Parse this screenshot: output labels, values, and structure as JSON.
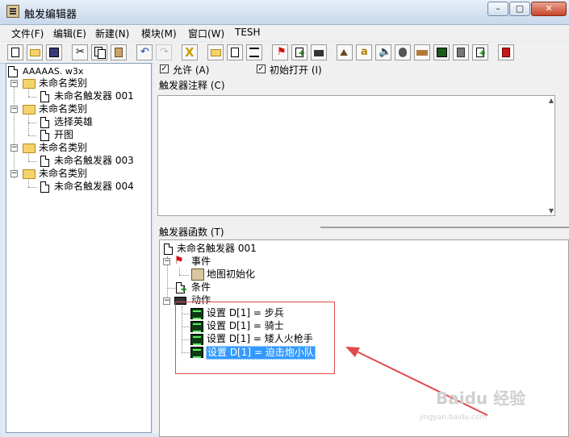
{
  "window": {
    "title": "触发编辑器"
  },
  "menu": [
    "文件(F)",
    "编辑(E)",
    "新建(N)",
    "模块(M)",
    "窗口(W)",
    "TESH"
  ],
  "left_tree": {
    "root": "AAAAAS. w3x",
    "categories": [
      {
        "label": "未命名类别",
        "children": [
          "未命名触发器 001"
        ]
      },
      {
        "label": "未命名类别",
        "children": [
          "选择英雄",
          "开图"
        ]
      },
      {
        "label": "未命名类别",
        "children": [
          "未命名触发器 003"
        ]
      },
      {
        "label": "未命名类别",
        "children": [
          "未命名触发器 004"
        ]
      }
    ]
  },
  "options": {
    "allow_label": "允许 (A)",
    "allow_checked": true,
    "initially_on_label": "初始打开 (I)",
    "initially_on_checked": true
  },
  "comment": {
    "label": "触发器注释 (C)",
    "value": ""
  },
  "functions": {
    "label": "触发器函数 (T)",
    "trigger_name": "未命名触发器 001",
    "events_label": "事件",
    "events": [
      "地图初始化"
    ],
    "conditions_label": "条件",
    "actions_label": "动作",
    "actions": [
      "设置 D[1] = 步兵",
      "设置 D[1] = 骑士",
      "设置 D[1] = 矮人火枪手",
      "设置 D[1] = 迫击炮小队"
    ],
    "selected_action_index": 3
  },
  "watermark": {
    "brand": "Baidu 经验",
    "url": "jingyan.baidu.com"
  },
  "colors": {
    "annotation_red": "#e04a4a",
    "selection_blue": "#3399ff"
  }
}
